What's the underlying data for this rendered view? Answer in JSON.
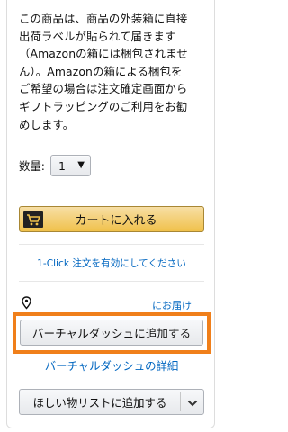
{
  "notice": {
    "lines": [
      "この商品は、商品の外装箱に直接",
      "出荷ラベルが貼られて届きます",
      "（Amazonの箱には梱包されませ",
      "ん）。Amazonの箱による梱包を",
      "ご希望の場合は注文確定画面から",
      "ギフトラッピングのご利用をお勧",
      "めします。"
    ]
  },
  "quantity": {
    "label": "数量:",
    "selected": "1"
  },
  "cart_button": {
    "label": "カートに入れる",
    "icon": "cart-icon"
  },
  "one_click_link": "1-Click 注文を有効にしてください",
  "delivery": {
    "icon": "location-pin-icon",
    "link": "にお届け"
  },
  "virtual_dash_button": {
    "label": "バーチャルダッシュに追加する"
  },
  "virtual_dash_details_link": "バーチャルダッシュの詳細",
  "wishlist": {
    "label": "ほしい物リストに追加する",
    "dropdown_icon": "chevron-down-icon"
  },
  "colors": {
    "link": "#0066c0",
    "cart_button": "#f0c14b",
    "highlight_frame": "#f07f1a"
  }
}
